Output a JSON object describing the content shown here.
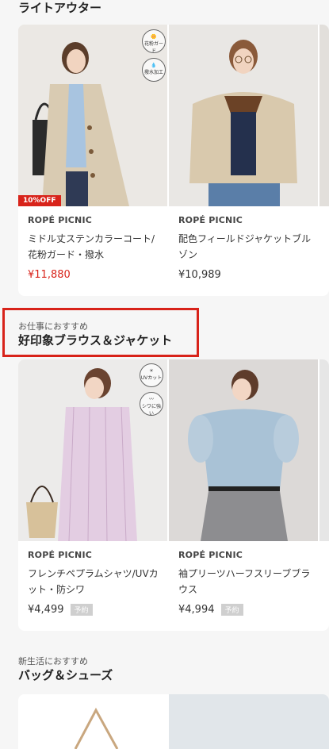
{
  "sections": {
    "light_outer": {
      "title": "ライトアウター"
    },
    "work": {
      "sub": "お仕事におすすめ",
      "title": "好印象ブラウス＆ジャケット"
    },
    "bags": {
      "sub": "新生活におすすめ",
      "title": "バッグ＆シューズ"
    }
  },
  "row1": [
    {
      "brand": "ROPÉ PICNIC",
      "name": "ミドル丈ステンカラーコート/花粉ガード・撥水",
      "price": "¥11,880",
      "badge": "10%OFF",
      "icons": [
        "花粉ガード",
        "撥水加工"
      ]
    },
    {
      "brand": "ROPÉ PICNIC",
      "name": "配色フィールドジャケットブルゾン",
      "price": "¥10,989"
    }
  ],
  "row2": [
    {
      "brand": "ROPÉ PICNIC",
      "name": "フレンチペプラムシャツ/UVカット・防シワ",
      "price": "¥4,499",
      "tag": "予約",
      "icons": [
        "UVカット",
        "シワに強い"
      ]
    },
    {
      "brand": "ROPÉ PICNIC",
      "name": "袖プリーツハーフスリーブブラウス",
      "price": "¥4,994",
      "tag": "予約"
    }
  ],
  "colors": {
    "accent": "#d8231a",
    "background": "#f6f6f6"
  }
}
